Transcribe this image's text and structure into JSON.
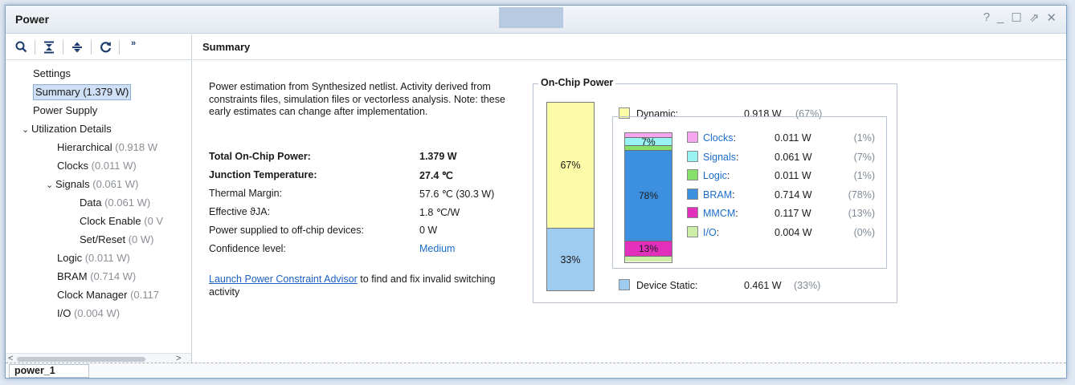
{
  "window": {
    "title": "Power",
    "controls": [
      "?",
      "_",
      "☐",
      "⇗",
      "✕"
    ]
  },
  "toolbar": {
    "icons": [
      "search-icon",
      "collapse-all-icon",
      "expand-all-icon",
      "refresh-icon",
      "more-icon"
    ],
    "more_label": "»"
  },
  "tree": {
    "items": [
      {
        "label": "Settings",
        "value": "",
        "indent": 0,
        "chevron": ""
      },
      {
        "label": "Summary (1.379 W)",
        "value": "",
        "indent": 0,
        "chevron": "",
        "selected": true
      },
      {
        "label": "Power Supply",
        "value": "",
        "indent": 0,
        "chevron": ""
      },
      {
        "label": "Utilization Details",
        "value": "",
        "indent": 0,
        "chevron": "⌄"
      },
      {
        "label": "Hierarchical",
        "value": "(0.918 W",
        "indent": 2,
        "chevron": ""
      },
      {
        "label": "Clocks",
        "value": "(0.011 W)",
        "indent": 2,
        "chevron": ""
      },
      {
        "label": "Signals",
        "value": "(0.061 W)",
        "indent": 1,
        "chevron": "⌄"
      },
      {
        "label": "Data",
        "value": "(0.061 W)",
        "indent": 3,
        "chevron": ""
      },
      {
        "label": "Clock Enable",
        "value": "(0 V",
        "indent": 3,
        "chevron": ""
      },
      {
        "label": "Set/Reset",
        "value": "(0 W)",
        "indent": 3,
        "chevron": ""
      },
      {
        "label": "Logic",
        "value": "(0.011 W)",
        "indent": 2,
        "chevron": ""
      },
      {
        "label": "BRAM",
        "value": "(0.714 W)",
        "indent": 2,
        "chevron": ""
      },
      {
        "label": "Clock Manager",
        "value": "(0.117",
        "indent": 2,
        "chevron": ""
      },
      {
        "label": "I/O",
        "value": "(0.004 W)",
        "indent": 2,
        "chevron": ""
      }
    ],
    "scroll_left": "<",
    "scroll_right": ">"
  },
  "summary": {
    "header": "Summary",
    "description": "Power estimation from Synthesized netlist. Activity derived from constraints files, simulation files or vectorless analysis. Note: these early estimates can change after implementation.",
    "stats": [
      {
        "label": "Total On-Chip Power:",
        "value": "1.379 W",
        "bold": true
      },
      {
        "label": "Junction Temperature:",
        "value": "27.4 ℃",
        "bold": true
      },
      {
        "label": "Thermal Margin:",
        "value": "57.6 ℃ (30.3 W)",
        "bold": false
      },
      {
        "label": "Effective ϑJA:",
        "value": "1.8 ℃/W",
        "bold": false
      },
      {
        "label": "Power supplied to off-chip devices:",
        "value": "0 W",
        "bold": false
      },
      {
        "label": "Confidence level:",
        "value": "Medium",
        "bold": false,
        "link": true
      }
    ],
    "advisor_link": "Launch Power Constraint Advisor",
    "advisor_text": " to find and fix invalid switching activity"
  },
  "on_chip_power": {
    "title": "On-Chip Power",
    "dynamic": {
      "label": "Dynamic:",
      "value": "0.918 W",
      "pct": "(67%)",
      "bar_pct": "67%",
      "color": "#fbfba8"
    },
    "static": {
      "label": "Device Static:",
      "value": "0.461 W",
      "pct": "(33%)",
      "bar_pct": "33%",
      "color": "#9ecbf0"
    },
    "breakdown": [
      {
        "name": "Clocks",
        "value": "0.011 W",
        "pct": "(1%)",
        "color": "#f5a6ee",
        "bar_label": ""
      },
      {
        "name": "Signals",
        "value": "0.061 W",
        "pct": "(7%)",
        "color": "#99f3f3",
        "bar_label": "7%"
      },
      {
        "name": "Logic",
        "value": "0.011 W",
        "pct": "(1%)",
        "color": "#86e06a",
        "bar_label": ""
      },
      {
        "name": "BRAM",
        "value": "0.714 W",
        "pct": "(78%)",
        "color": "#3d8fe0",
        "bar_label": "78%"
      },
      {
        "name": "MMCM",
        "value": "0.117 W",
        "pct": "(13%)",
        "color": "#e22fbc",
        "bar_label": "13%"
      },
      {
        "name": "I/O",
        "value": "0.004 W",
        "pct": "(0%)",
        "color": "#cdeea8",
        "bar_label": ""
      }
    ]
  },
  "bottom_tab": "power_1"
}
